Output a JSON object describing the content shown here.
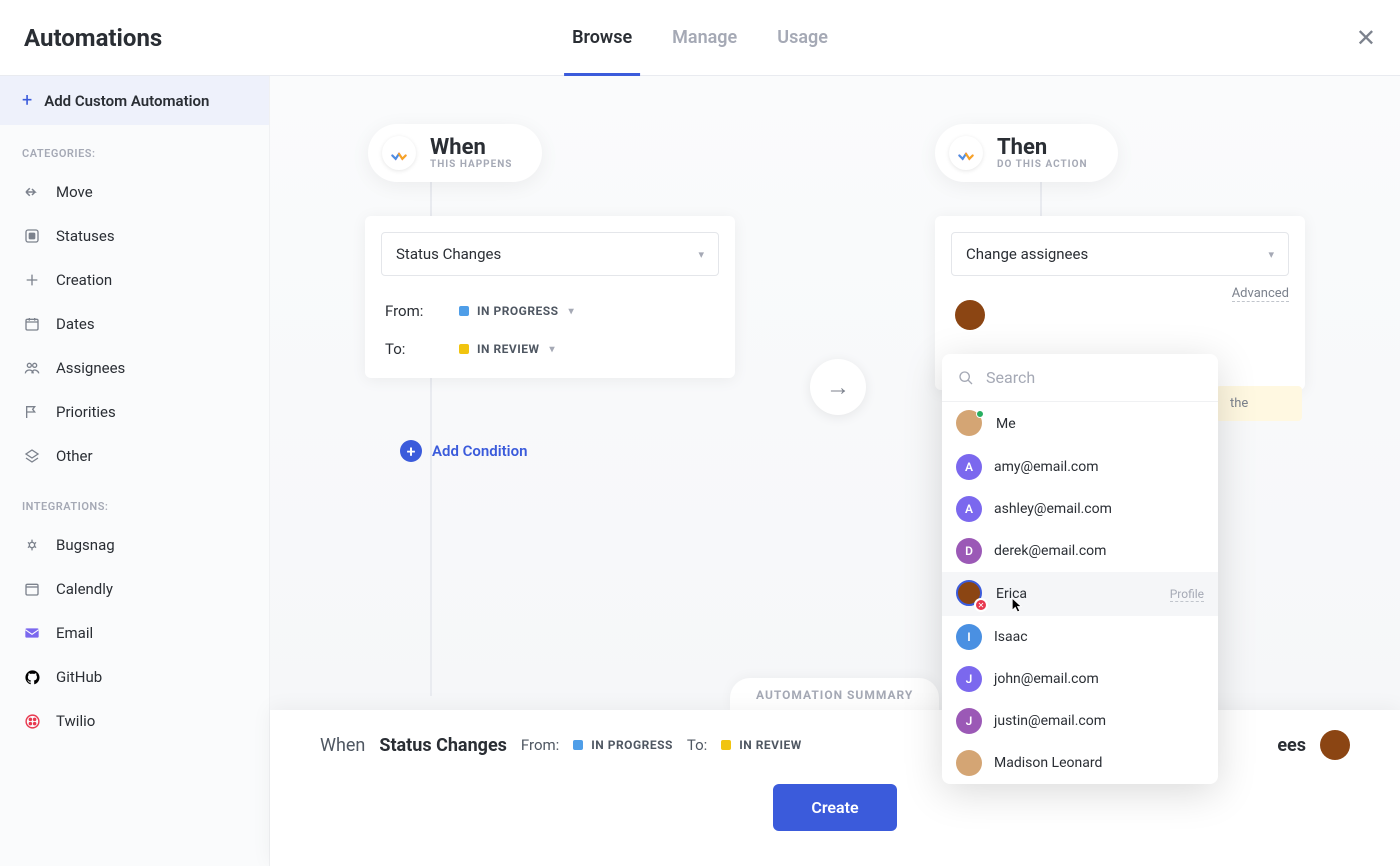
{
  "header": {
    "title": "Automations",
    "tabs": [
      "Browse",
      "Manage",
      "Usage"
    ],
    "activeTab": 0
  },
  "sidebar": {
    "addCustom": "Add Custom Automation",
    "categoriesLabel": "CATEGORIES:",
    "categories": [
      {
        "icon": "move",
        "label": "Move"
      },
      {
        "icon": "statuses",
        "label": "Statuses"
      },
      {
        "icon": "creation",
        "label": "Creation"
      },
      {
        "icon": "dates",
        "label": "Dates"
      },
      {
        "icon": "assignees",
        "label": "Assignees"
      },
      {
        "icon": "priorities",
        "label": "Priorities"
      },
      {
        "icon": "other",
        "label": "Other"
      }
    ],
    "integrationsLabel": "INTEGRATIONS:",
    "integrations": [
      {
        "icon": "bugsnag",
        "label": "Bugsnag"
      },
      {
        "icon": "calendly",
        "label": "Calendly"
      },
      {
        "icon": "email",
        "label": "Email"
      },
      {
        "icon": "github",
        "label": "GitHub"
      },
      {
        "icon": "twilio",
        "label": "Twilio"
      }
    ]
  },
  "when": {
    "title": "When",
    "subtitle": "THIS HAPPENS",
    "trigger": "Status Changes",
    "fromLabel": "From:",
    "fromStatus": "IN PROGRESS",
    "fromColor": "#4f9ee8",
    "toLabel": "To:",
    "toStatus": "IN REVIEW",
    "toColor": "#f1c40f",
    "addCondition": "Add Condition"
  },
  "then": {
    "title": "Then",
    "subtitle": "DO THIS ACTION",
    "action": "Change assignees",
    "advanced": "Advanced",
    "noteText": "the"
  },
  "assigneeDropdown": {
    "searchPlaceholder": "Search",
    "items": [
      {
        "label": "Me",
        "avatarType": "photo",
        "color": "#d4a574",
        "greenDot": true
      },
      {
        "label": "amy@email.com",
        "avatarType": "initial",
        "initial": "A",
        "color": "#7b68ee"
      },
      {
        "label": "ashley@email.com",
        "avatarType": "initial",
        "initial": "A",
        "color": "#7b68ee"
      },
      {
        "label": "derek@email.com",
        "avatarType": "initial",
        "initial": "D",
        "color": "#9b59b6"
      },
      {
        "label": "Erica",
        "avatarType": "photo",
        "color": "#8b4513",
        "hover": true,
        "profile": "Profile",
        "removeBadge": true
      },
      {
        "label": "Isaac",
        "avatarType": "initial",
        "initial": "I",
        "color": "#4a90e2"
      },
      {
        "label": "john@email.com",
        "avatarType": "initial",
        "initial": "J",
        "color": "#7b68ee"
      },
      {
        "label": "justin@email.com",
        "avatarType": "initial",
        "initial": "J",
        "color": "#9b59b6"
      },
      {
        "label": "Madison Leonard",
        "avatarType": "photo",
        "color": "#d4a574"
      }
    ]
  },
  "summary": {
    "tabLabel": "AUTOMATION SUMMARY",
    "whenPrefix": "When",
    "whenBold": "Status Changes",
    "fromLabel": "From:",
    "fromStatus": "IN PROGRESS",
    "toLabel": "To:",
    "toStatus": "IN REVIEW",
    "thenAction": "ees",
    "createLabel": "Create"
  }
}
